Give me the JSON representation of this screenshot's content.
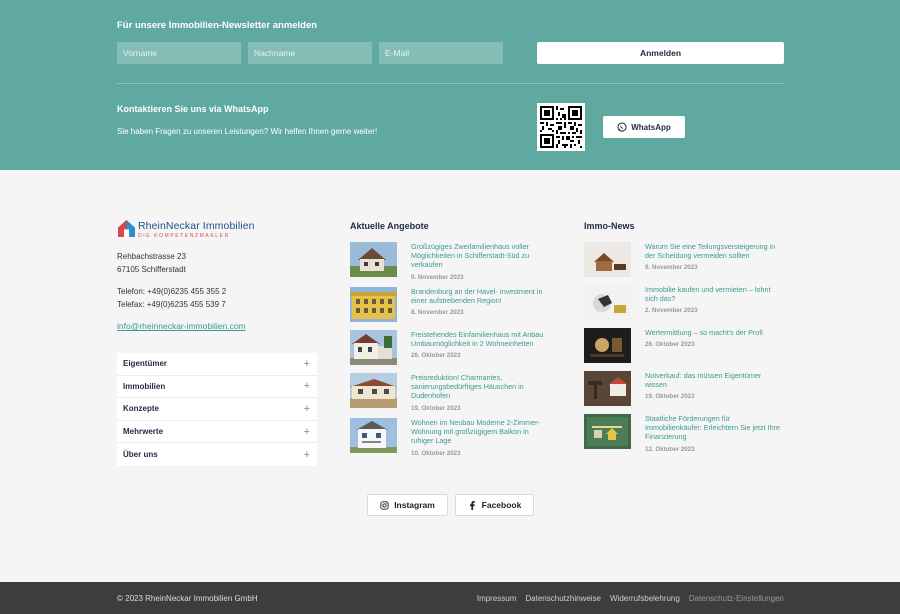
{
  "newsletter": {
    "title": "Für unsere Immobilien-Newsletter anmelden",
    "first_name_placeholder": "Vorname",
    "last_name_placeholder": "Nachname",
    "email_placeholder": "E-Mail",
    "submit_label": "Anmelden"
  },
  "whatsapp": {
    "title": "Kontaktieren Sie uns via WhatsApp",
    "text": "Sie haben Fragen zu unseren Leistungen? Wir helfen Ihnen gerne weiter!",
    "button_label": "WhatsApp"
  },
  "contact": {
    "logo_name": "RheinNeckar Immobilien",
    "logo_sub": "DIE KOMPETENZMAKLER",
    "street": "Rehbachstrasse 23",
    "city": "67105 Schifferstadt",
    "phone": "Telefon: +49(0)6235 455 355 2",
    "fax": "Telefax: +49(0)6235 455 539 7",
    "email": "info@rheinneckar-immobilien.com"
  },
  "accordion": [
    {
      "label": "Eigentümer"
    },
    {
      "label": "Immobilien"
    },
    {
      "label": "Konzepte"
    },
    {
      "label": "Mehrwerte"
    },
    {
      "label": "Über uns"
    }
  ],
  "offers": {
    "title": "Aktuelle Angebote",
    "items": [
      {
        "title": "Großzügiges Zweifamilienhaus voller Möglichkeiten in Schifferstadt-Süd zu verkaufen",
        "date": "9. November 2023"
      },
      {
        "title": "Brandenburg an der Havel- Investment in einer aufstrebenden Region!",
        "date": "8. November 2023"
      },
      {
        "title": "Freistehendes Einfamilienhaus mit Anbau Umbaumöglichkeit in 2 Wohneinheiten",
        "date": "26. Oktober 2023"
      },
      {
        "title": "Preisreduktion! Charmantes, sanierungsbedürftiges Häuschen in Dudenhofen",
        "date": "19. Oktober 2023"
      },
      {
        "title": "Wohnen im Neubau Moderne 2-Zimmer-Wohnung mit großzügigem Balkon in ruhiger Lage",
        "date": "10. Oktober 2023"
      }
    ]
  },
  "news": {
    "title": "Immo-News",
    "items": [
      {
        "title": "Warum Sie eine Teilungsversteigerung in der Scheidung vermeiden sollten",
        "date": "9. November 2023"
      },
      {
        "title": "Immobilie kaufen und vermieten – lohnt sich das?",
        "date": "2. November 2023"
      },
      {
        "title": "Wertermittlung – so macht's der Profi",
        "date": "26. Oktober 2023"
      },
      {
        "title": "Notverkauf: das müssen Eigentümer wissen",
        "date": "19. Oktober 2023"
      },
      {
        "title": "Staatliche Förderungen für Immobilienkäufer: Erleichtern Sie jetzt Ihre Finanzierung",
        "date": "12. Oktober 2023"
      }
    ]
  },
  "social": {
    "instagram": "Instagram",
    "facebook": "Facebook"
  },
  "footer": {
    "copyright": "© 2023 RheinNeckar Immobilien GmbH",
    "links": [
      "Impressum",
      "Datenschutzhinweise",
      "Widerrufsbelehrung",
      "Datenschutz-Einstellungen"
    ]
  },
  "colors": {
    "teal_band": "#5fa9a1",
    "link_teal": "#3b9a8f",
    "navy": "#1f2a44",
    "footer_bg": "#3d3d3d"
  }
}
